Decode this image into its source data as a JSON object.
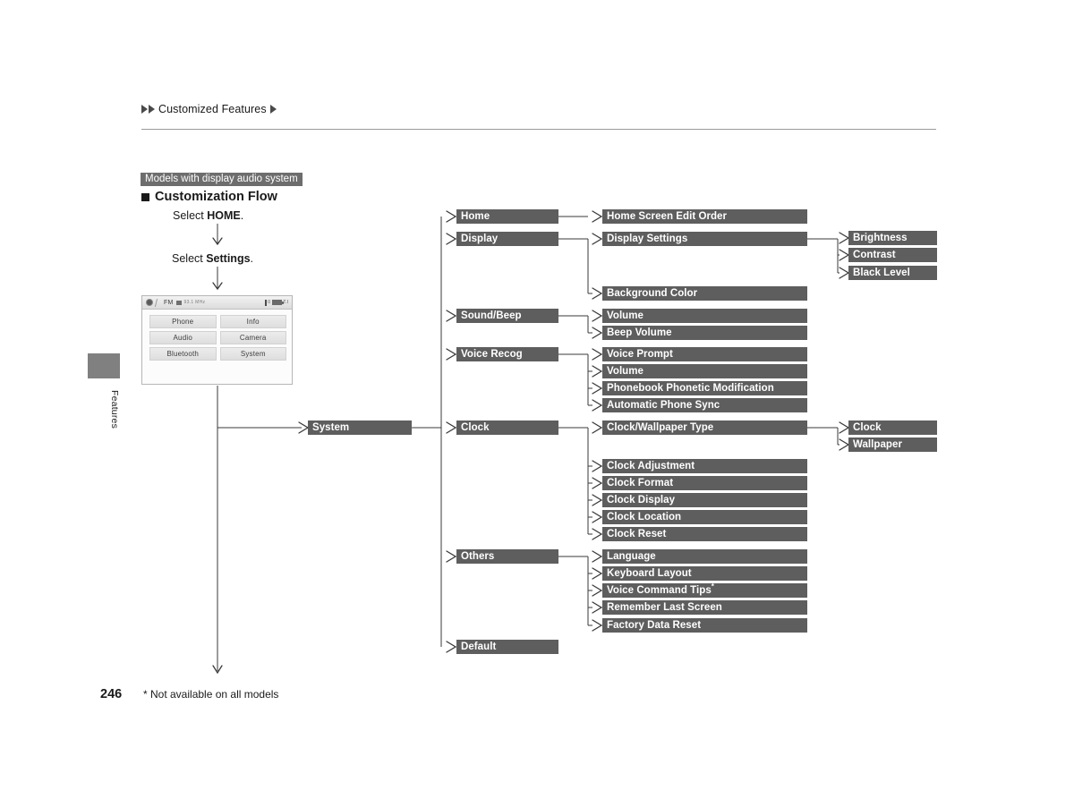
{
  "header": {
    "breadcrumb_text": "Customized Features",
    "triangle_icon": "triangle-right-icon"
  },
  "side_tab": {
    "label": "Features"
  },
  "section": {
    "models_banner": "Models with display audio system",
    "title": "Customization Flow",
    "step_home_prefix": "Select ",
    "step_home_bold": "HOME",
    "step_home_suffix": ".",
    "step_settings_prefix": "Select ",
    "step_settings_bold": "Settings",
    "step_settings_suffix": "."
  },
  "device": {
    "status_band": "FM",
    "status_freq": "93.1 MHz",
    "keys": [
      "Phone",
      "Info",
      "Audio",
      "Camera",
      "Bluetooth",
      "System"
    ]
  },
  "flow": {
    "col1": [
      {
        "label": "System"
      }
    ],
    "col2": [
      {
        "label": "Home"
      },
      {
        "label": "Display"
      },
      {
        "label": "Sound/Beep"
      },
      {
        "label": "Voice Recog"
      },
      {
        "label": "Clock"
      },
      {
        "label": "Others"
      },
      {
        "label": "Default"
      }
    ],
    "col3": [
      {
        "label": "Home Screen Edit Order"
      },
      {
        "label": "Display Settings"
      },
      {
        "label": "Background Color"
      },
      {
        "label": "Volume"
      },
      {
        "label": "Beep Volume"
      },
      {
        "label": "Voice Prompt"
      },
      {
        "label": "Volume"
      },
      {
        "label": "Phonebook Phonetic Modification"
      },
      {
        "label": "Automatic Phone Sync"
      },
      {
        "label": "Clock/Wallpaper Type"
      },
      {
        "label": "Clock Adjustment"
      },
      {
        "label": "Clock Format"
      },
      {
        "label": "Clock Display"
      },
      {
        "label": "Clock Location"
      },
      {
        "label": "Clock Reset"
      },
      {
        "label": "Language"
      },
      {
        "label": "Keyboard Layout"
      },
      {
        "label": "Voice Command Tips",
        "footnote": "*"
      },
      {
        "label": "Remember Last Screen"
      },
      {
        "label": "Factory Data Reset"
      }
    ],
    "col4": [
      {
        "label": "Brightness"
      },
      {
        "label": "Contrast"
      },
      {
        "label": "Black Level"
      },
      {
        "label": "Clock"
      },
      {
        "label": "Wallpaper"
      }
    ]
  },
  "footer": {
    "page_number": "246",
    "footnote": "* Not available on all models"
  },
  "colors": {
    "node_fill": "#5e5e5e",
    "banner_fill": "#6d6d6d",
    "line": "#3a3a3a",
    "side_tab": "#808080"
  }
}
